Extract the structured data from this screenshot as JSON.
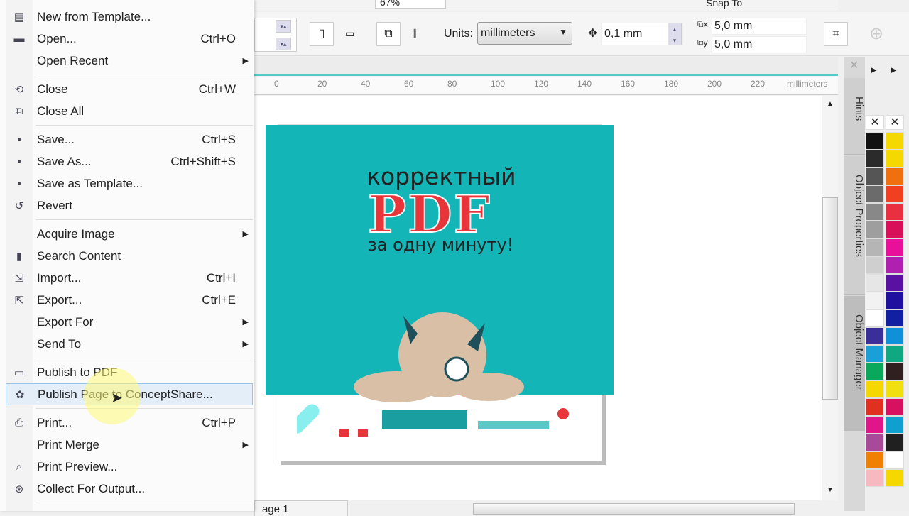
{
  "toolbar": {
    "zoom": "67%",
    "snap_to": "Snap To",
    "units_label": "Units:",
    "units_value": "millimeters",
    "nudge": "0,1 mm",
    "dup_x": "5,0 mm",
    "dup_y": "5,0 mm"
  },
  "ruler": {
    "ticks": [
      "0",
      "20",
      "40",
      "60",
      "80",
      "100",
      "120",
      "140",
      "160",
      "180",
      "200",
      "220"
    ],
    "unit": "millimeters"
  },
  "page_tab": "age 1",
  "artwork": {
    "line1": "корректный",
    "line2": "PDF",
    "line3": "за одну минуту!",
    "bg": "#14b5b6",
    "pdf_color": "#e8353a"
  },
  "docker": {
    "tabs": [
      "Hints",
      "Object Properties",
      "Object Manager"
    ]
  },
  "palette": {
    "left": [
      "#111111",
      "#2b2b2b",
      "#555555",
      "#6b6b6b",
      "#888888",
      "#9e9e9e",
      "#b5b5b5",
      "#cfcfcf",
      "#e6e6e6",
      "#f2f2f2",
      "#ffffff",
      "#3a2e9a",
      "#1aa0d8",
      "#0aa85a",
      "#f5d800",
      "#e03020",
      "#e0158a",
      "#a84a9a",
      "#f08000",
      "#f8b8c0"
    ],
    "right": [
      "#f5d800",
      "#f5d800",
      "#f07010",
      "#f04020",
      "#e83040",
      "#d8105a",
      "#e8109a",
      "#b020b0",
      "#5a10a0",
      "#2010a0",
      "#1020a0",
      "#1090d8",
      "#10a880",
      "#302020",
      "#f0e010",
      "#d81060",
      "#10a0d0",
      "#202020",
      "#ffffff",
      "#f5d800"
    ]
  },
  "menu": [
    {
      "label": "New from Template...",
      "icon": "template-icon"
    },
    {
      "label": "Open...",
      "shortcut": "Ctrl+O",
      "icon": "folder-icon"
    },
    {
      "label": "Open Recent",
      "submenu": true
    },
    {
      "sep": true
    },
    {
      "label": "Close",
      "shortcut": "Ctrl+W",
      "icon": "close-file-icon"
    },
    {
      "label": "Close All",
      "icon": "close-all-icon"
    },
    {
      "sep": true
    },
    {
      "label": "Save...",
      "shortcut": "Ctrl+S",
      "icon": "save-icon"
    },
    {
      "label": "Save As...",
      "shortcut": "Ctrl+Shift+S",
      "icon": "save-as-icon"
    },
    {
      "label": "Save as Template...",
      "icon": "save-template-icon"
    },
    {
      "label": "Revert",
      "icon": "revert-icon"
    },
    {
      "sep": true
    },
    {
      "label": "Acquire Image",
      "submenu": true
    },
    {
      "label": "Search Content",
      "icon": "search-content-icon"
    },
    {
      "label": "Import...",
      "shortcut": "Ctrl+I",
      "icon": "import-icon"
    },
    {
      "label": "Export...",
      "shortcut": "Ctrl+E",
      "icon": "export-icon"
    },
    {
      "label": "Export For",
      "submenu": true
    },
    {
      "label": "Send To",
      "submenu": true
    },
    {
      "sep": true
    },
    {
      "label": "Publish to PDF",
      "icon": "pdf-icon"
    },
    {
      "label": "Publish Page to ConceptShare...",
      "icon": "conceptshare-icon",
      "highlight": true
    },
    {
      "sep": true
    },
    {
      "label": "Print...",
      "shortcut": "Ctrl+P",
      "icon": "print-icon"
    },
    {
      "label": "Print Merge",
      "submenu": true
    },
    {
      "label": "Print Preview...",
      "icon": "print-preview-icon"
    },
    {
      "label": "Collect For Output...",
      "icon": "collect-icon"
    },
    {
      "sep": true
    }
  ]
}
